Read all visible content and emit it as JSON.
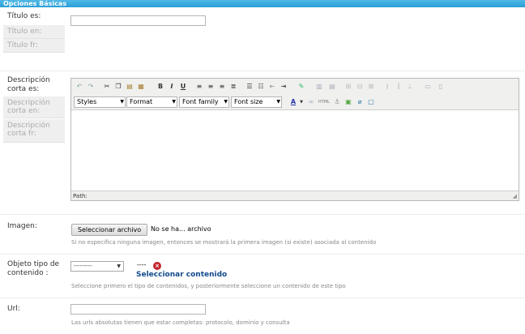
{
  "section": {
    "title": "Opciones Básicas"
  },
  "titulo": {
    "label": "Título es:",
    "lang_tabs": [
      "Título en:",
      "Título fr:"
    ],
    "value": ""
  },
  "descripcion": {
    "label_line1": "Descripción",
    "label_line2": "corta es:",
    "lang_tabs": [
      {
        "line1": "Descripción",
        "line2": "corta en:"
      },
      {
        "line1": "Descripción",
        "line2": "corta fr:"
      }
    ],
    "editor": {
      "dropdowns": [
        "Styles",
        "Format",
        "Font family",
        "Font size"
      ],
      "path_label": "Path:",
      "toolbar_icons": [
        "undo-icon",
        "redo-icon",
        "cut-icon",
        "copy-icon",
        "paste-icon",
        "paste-word-icon",
        "bold-icon",
        "italic-icon",
        "underline-icon",
        "align-left-icon",
        "align-center-icon",
        "align-right-icon",
        "align-justify-icon",
        "bullet-list-icon",
        "numbered-list-icon",
        "outdent-icon",
        "indent-icon",
        "edit-html-icon",
        "table-icon",
        "table-props-icon",
        "row-insert-icon",
        "col-insert-icon",
        "merge-icon",
        "split-icon"
      ],
      "toolbar_glyphs": {
        "bold": "B",
        "italic": "I",
        "underline": "U",
        "text_color": "A",
        "html": "HTML"
      }
    }
  },
  "imagen": {
    "label": "Imagen:",
    "button_label": "Seleccionar archivo",
    "file_status": "No se ha... archivo",
    "help": "Si no especifica ninguna imagen, entonces se mostrará la primera imagen (si existe) asociada al contenido"
  },
  "objeto": {
    "label_line1": "Objeto tipo de",
    "label_line2": "contenido :",
    "select_value": "---------",
    "dash_value": "----",
    "select_link": "Seleccionar contenido",
    "error_glyph": "×",
    "help": "Seleccione primero el tipo de contenidos, y posteriormente seleccione un contenido de este tipo"
  },
  "url": {
    "label": "Url:",
    "value": "",
    "help": "Las urls absolutas tienen que estar completas: protocolo, dominio y consulta"
  },
  "colors": {
    "header": "#2a9fd6",
    "link": "#124a8c",
    "error": "#c4262e"
  }
}
